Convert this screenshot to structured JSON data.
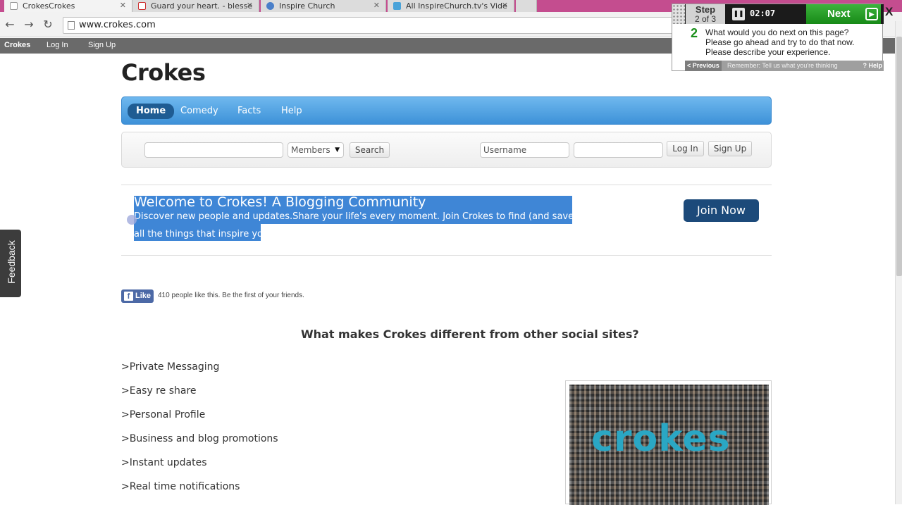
{
  "browser": {
    "tabs": [
      {
        "title": "CrokesCrokes",
        "icon": "page-icon",
        "active": true
      },
      {
        "title": "Guard your heart. - blesse",
        "icon": "gmail-icon",
        "active": false
      },
      {
        "title": "Inspire Church",
        "icon": "globe-icon",
        "active": false
      },
      {
        "title": "All InspireChurch.tv's Vide",
        "icon": "vimeo-icon",
        "active": false
      }
    ],
    "tab_close": "✕",
    "url": "www.crokes.com",
    "back": "←",
    "forward": "→",
    "reload": "↻"
  },
  "sitebar": {
    "brand": "Crokes",
    "login": "Log In",
    "signup": "Sign Up"
  },
  "feedback": "Feedback",
  "site": {
    "title": "Crokes",
    "nav": [
      "Home",
      "Comedy",
      "Facts",
      "Help"
    ],
    "search": {
      "query": "",
      "scope": "Members",
      "scope_arrow": "▼",
      "button": "Search",
      "username_placeholder": "Username",
      "password": "",
      "login": "Log In",
      "signup": "Sign Up"
    },
    "welcome": {
      "title": "Welcome to Crokes! A Blogging Community",
      "line1": "Discover new people and updates.Share your life's every moment. Join Crokes to find (and save!)",
      "line2": "all the things that inspire you"
    },
    "join_button": "Join Now",
    "facebook": {
      "icon": "f",
      "like": "Like",
      "text": "410 people like this. Be the first of your friends."
    },
    "heading": "What makes Crokes different from other social sites?",
    "features": [
      ">Private Messaging",
      ">Easy re share",
      ">Personal Profile",
      ">Business and blog promotions",
      ">Instant updates",
      ">Real time notifications"
    ],
    "collage_logo": "crokes"
  },
  "widget": {
    "step_label": "Step",
    "step_count": "2 of 3",
    "pause": "❚❚",
    "timer": "02:07",
    "next": "Next",
    "next_icon": "▶",
    "close": "X",
    "task_number": "2",
    "task_lines": [
      "What would you do next on this page?",
      "Please go ahead and try to do that now.",
      "Please describe your experience."
    ],
    "previous": "< Previous",
    "reminder": "Remember: Tell us what you're thinking",
    "help": "? Help"
  },
  "colors": {
    "nav_blue": "#3d91d8",
    "join_button": "#1c4a7a",
    "selection": "#3f86d6",
    "next_green": "#178a17"
  }
}
